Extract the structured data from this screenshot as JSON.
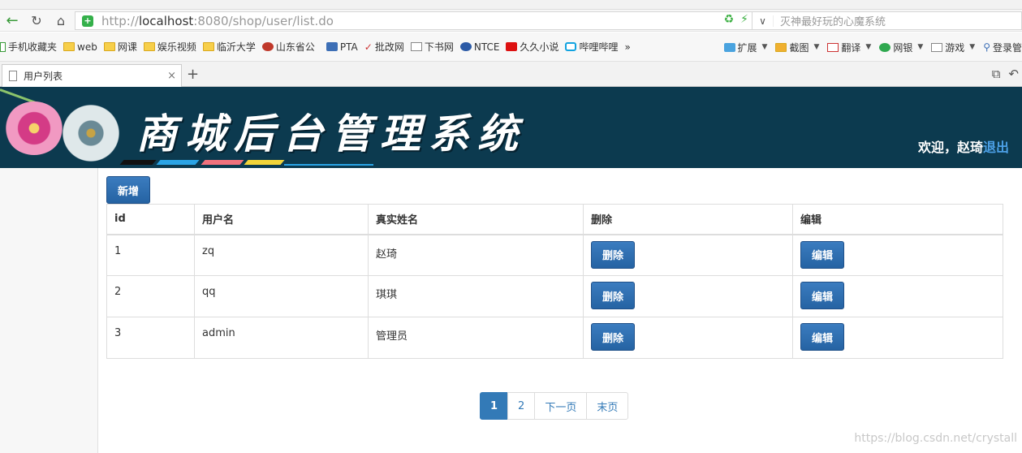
{
  "browser": {
    "url_prefix": "http://",
    "url_host": "localhost",
    "url_rest": ":8080/shop/user/list.do",
    "search_placeholder": "灭神最好玩的心魔系统",
    "tab_title": "用户列表",
    "tab_close": "×",
    "new_tab": "+"
  },
  "bookmarks": {
    "items": [
      {
        "label": "手机收藏夹",
        "icon": "phone-icon"
      },
      {
        "label": "web",
        "icon": "folder-icon"
      },
      {
        "label": "网课",
        "icon": "folder-icon"
      },
      {
        "label": "娱乐视频",
        "icon": "folder-icon"
      },
      {
        "label": "临沂大学",
        "icon": "folder-icon"
      },
      {
        "label": "山东省公",
        "icon": "emblem-icon"
      },
      {
        "label": "PTA",
        "icon": "pta-icon"
      },
      {
        "label": "批改网",
        "icon": "check-icon"
      },
      {
        "label": "下书网",
        "icon": "book-icon"
      },
      {
        "label": "NTCE",
        "icon": "globe-icon"
      },
      {
        "label": "久久小说",
        "icon": "jiujiu-icon"
      },
      {
        "label": "哔哩哔哩",
        "icon": "bilibili-icon"
      }
    ],
    "more": "»",
    "right": [
      {
        "label": "扩展"
      },
      {
        "label": "截图"
      },
      {
        "label": "翻译"
      },
      {
        "label": "网银"
      },
      {
        "label": "游戏"
      },
      {
        "label": "登录管"
      }
    ]
  },
  "header": {
    "title": "商城后台管理系统",
    "welcome_prefix": "欢迎，赵琦",
    "logout": "退出"
  },
  "main": {
    "add_button": "新增",
    "columns": [
      "id",
      "用户名",
      "真实姓名",
      "删除",
      "编辑"
    ],
    "rows": [
      {
        "id": "1",
        "username": "zq",
        "realname": "赵琦",
        "delete": "删除",
        "edit": "编辑"
      },
      {
        "id": "2",
        "username": "qq",
        "realname": "琪琪",
        "delete": "删除",
        "edit": "编辑"
      },
      {
        "id": "3",
        "username": "admin",
        "realname": "管理员",
        "delete": "删除",
        "edit": "编辑"
      }
    ],
    "pagination": {
      "pages": [
        "1",
        "2"
      ],
      "active": "1",
      "next": "下一页",
      "last": "末页"
    }
  },
  "watermark": "https://blog.csdn.net/crystall",
  "colors": {
    "header_bg": "#0c3a4f",
    "primary": "#337ab7",
    "logout_link": "#4ca0e6"
  }
}
